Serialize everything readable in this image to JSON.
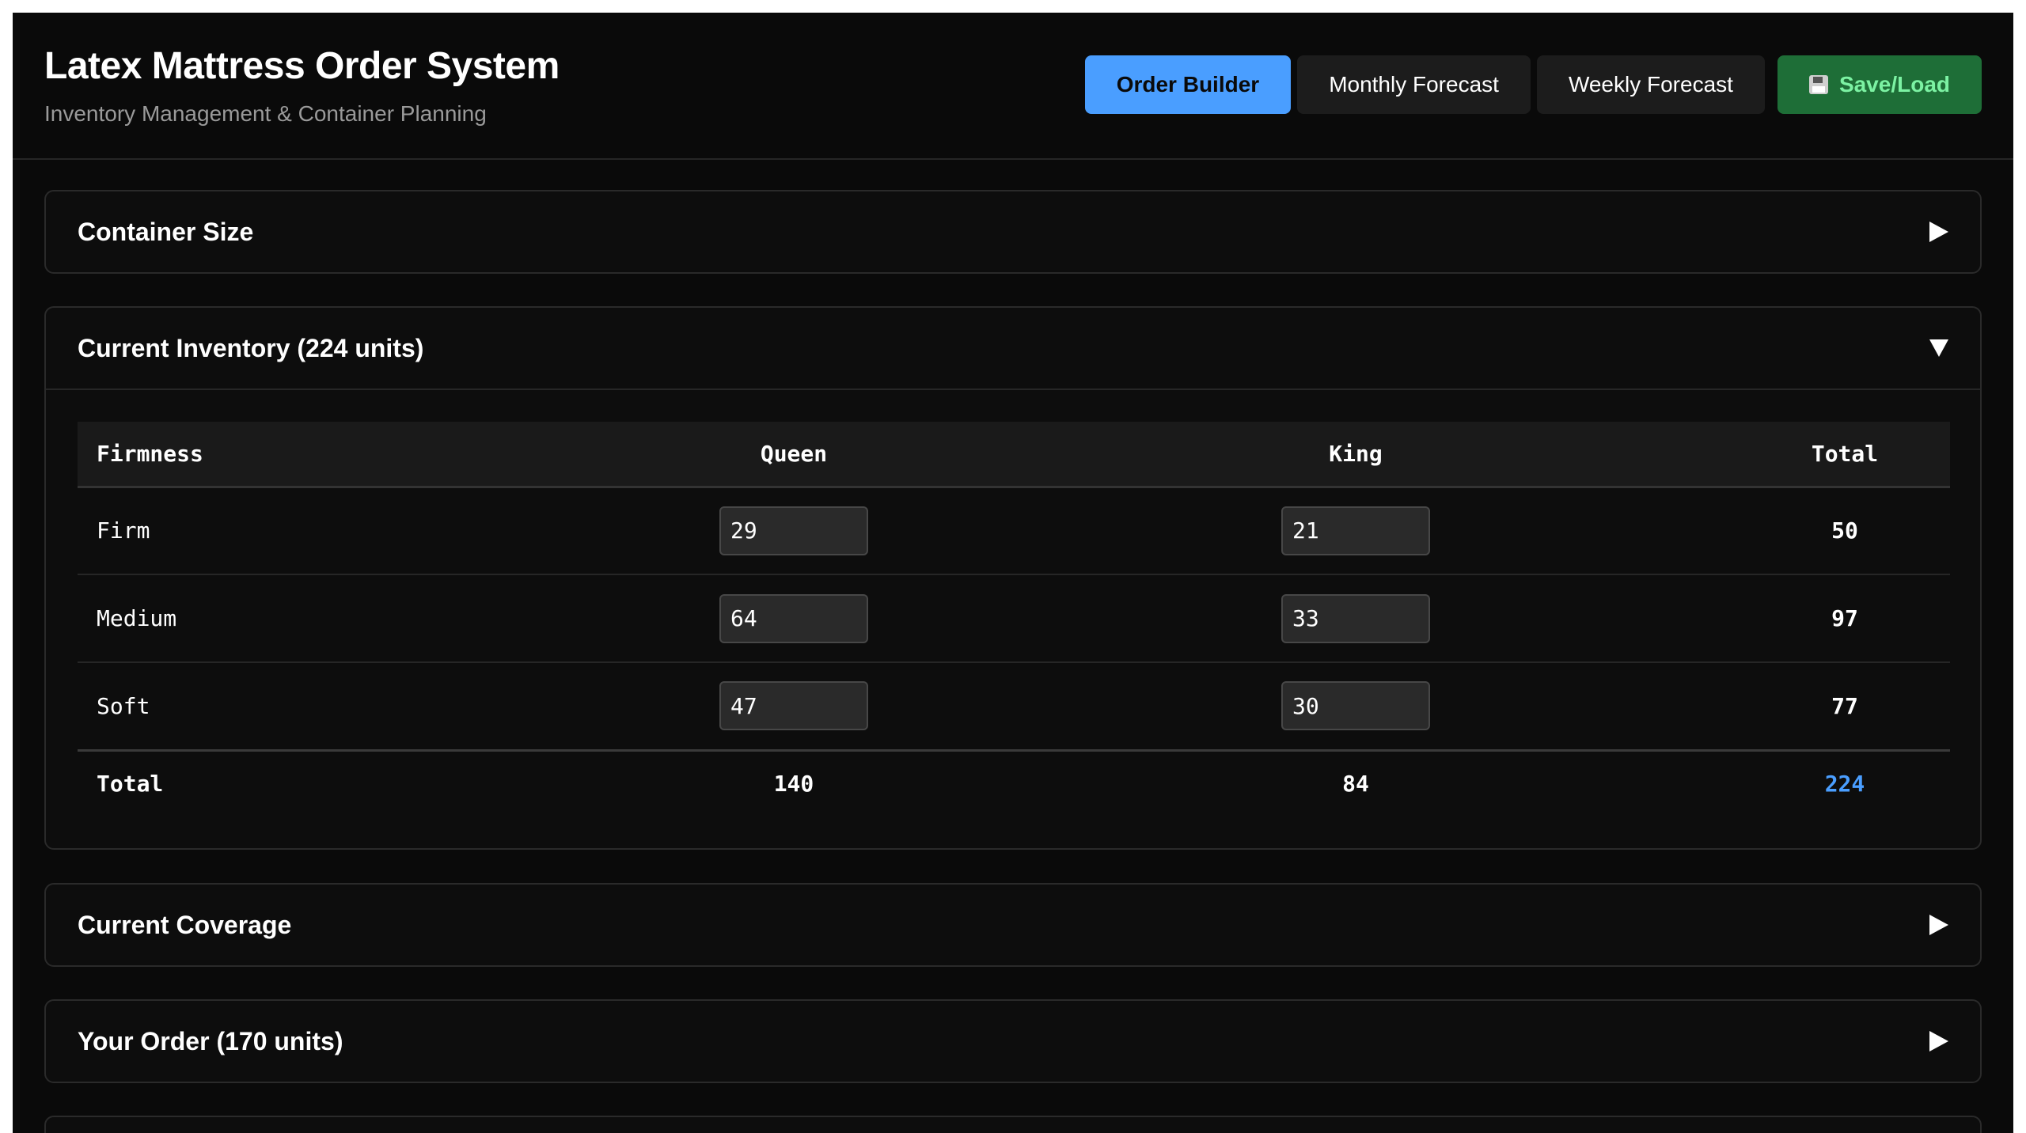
{
  "header": {
    "title": "Latex Mattress Order System",
    "subtitle": "Inventory Management & Container Planning",
    "nav": {
      "order_builder": "Order Builder",
      "monthly_forecast": "Monthly Forecast",
      "weekly_forecast": "Weekly Forecast",
      "save_load": "Save/Load",
      "save_icon": "floppy-disk-icon"
    }
  },
  "colors": {
    "accent": "#4a9eff",
    "save_bg": "#1e6e37",
    "save_text": "#7cf2a3",
    "background": "#0a0a0a"
  },
  "panels": {
    "container_size": {
      "title": "Container Size",
      "expanded": false
    },
    "current_inventory": {
      "title": "Current Inventory (224 units)",
      "expanded": true
    },
    "current_coverage": {
      "title": "Current Coverage",
      "expanded": false
    },
    "your_order": {
      "title": "Your Order (170 units)",
      "expanded": false
    }
  },
  "inventory": {
    "headers": [
      "Firmness",
      "Queen",
      "King",
      "Total"
    ],
    "rows": [
      {
        "firmness": "Firm",
        "queen": "29",
        "king": "21",
        "total": "50"
      },
      {
        "firmness": "Medium",
        "queen": "64",
        "king": "33",
        "total": "97"
      },
      {
        "firmness": "Soft",
        "queen": "47",
        "king": "30",
        "total": "77"
      }
    ],
    "totals": {
      "label": "Total",
      "queen": "140",
      "king": "84",
      "total": "224"
    }
  }
}
